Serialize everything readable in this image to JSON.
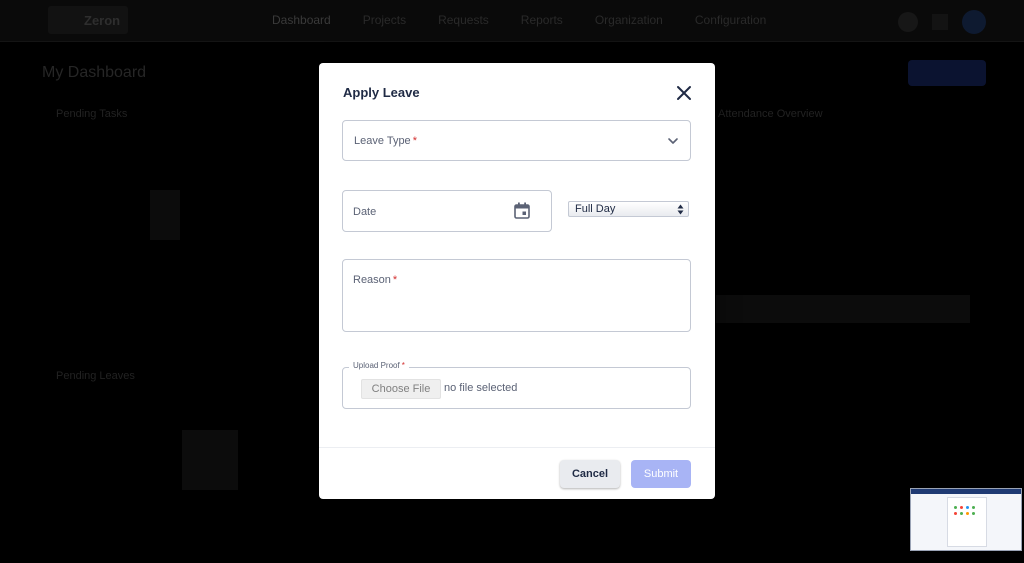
{
  "background_app": {
    "logo_text": "Zeron",
    "nav_items": [
      "Dashboard",
      "Projects",
      "Requests",
      "Reports",
      "Organization",
      "Configuration"
    ],
    "page_title": "My Dashboard",
    "panel_labels": [
      "Pending Tasks",
      "Pending Leaves",
      "Attendance Overview"
    ],
    "colors": {
      "nav_bg": "#0a0a0a",
      "accent": "#1f3a73"
    }
  },
  "modal": {
    "title": "Apply Leave",
    "close_icon": "close-icon",
    "leave_type": {
      "label": "Leave Type",
      "required_mark": "*",
      "icon": "chevron-down-icon"
    },
    "date": {
      "label": "Date",
      "icon": "calendar-icon"
    },
    "day_select": {
      "selected": "Full Day",
      "icon": "updown-arrows-icon"
    },
    "reason": {
      "label": "Reason",
      "required_mark": "*"
    },
    "upload": {
      "label": "Upload Proof",
      "required_mark": "*",
      "button_label": "Choose File",
      "status": "no file selected"
    },
    "cancel_label": "Cancel",
    "submit_label": "Submit",
    "colors": {
      "required": "#d32f2f",
      "submit_disabled": "#a8b4f5",
      "title": "#1f2a44"
    }
  }
}
